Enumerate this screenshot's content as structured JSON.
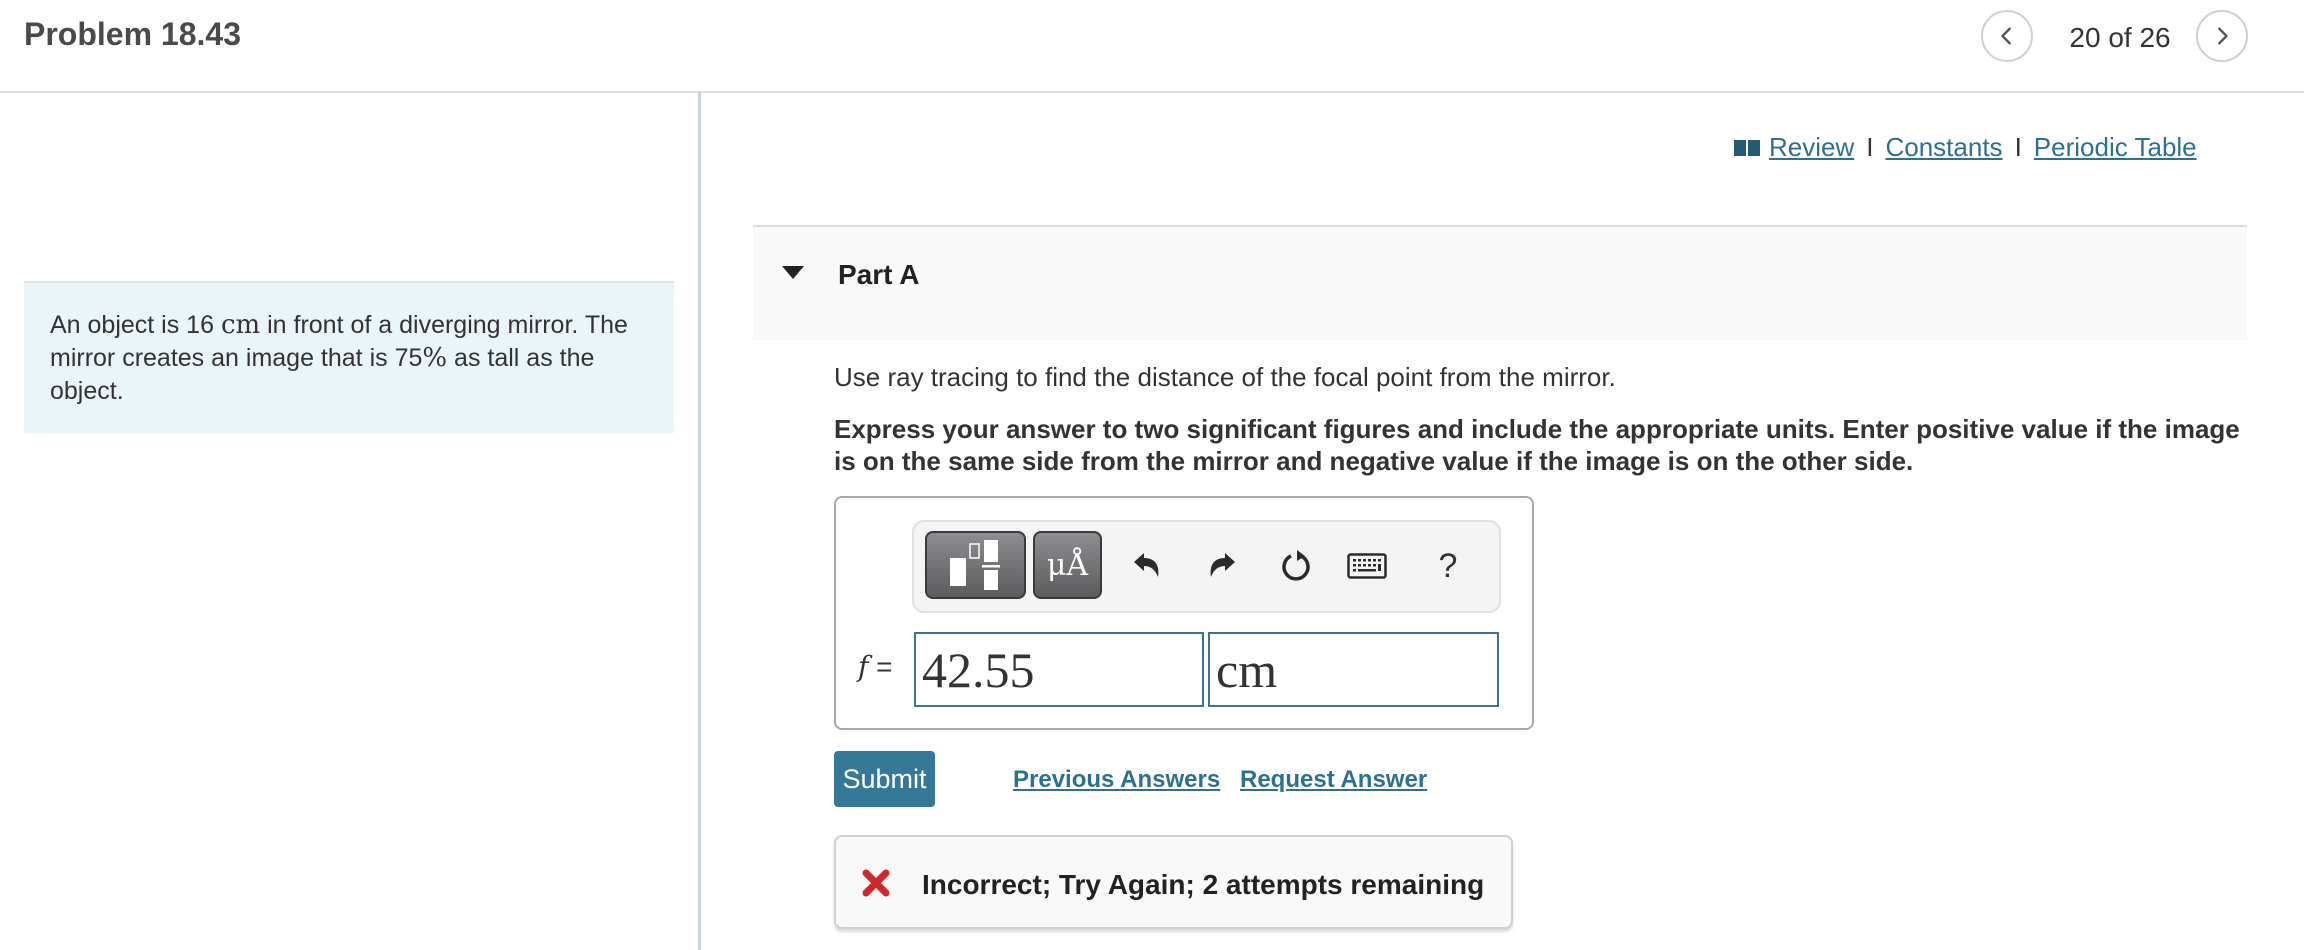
{
  "header": {
    "title": "Problem 18.43",
    "counter": "20 of 26",
    "prev_icon": "chevron-left-icon",
    "next_icon": "chevron-right-icon"
  },
  "statement": {
    "part1": "An object is 16 ",
    "unit": "cm",
    "part2": " in front of a diverging mirror. The mirror creates an image that is 75",
    "percent": "%",
    "part3": " as tall as the object."
  },
  "links": {
    "icon": "book-icon",
    "review": "Review",
    "separator": "I",
    "constants": "Constants",
    "periodic_table": "Periodic Table"
  },
  "part": {
    "title": "Part A",
    "expanded": true,
    "question": "Use ray tracing to find the distance of the focal point from the mirror.",
    "instructions": "Express your answer to two significant figures and include the appropriate units. Enter positive value if the image is on the same side from the mirror and negative value if the image is on the other side."
  },
  "answer": {
    "variable": "f",
    "equals": "=",
    "value": "42.55",
    "units": "cm",
    "toolbar": {
      "template_icon": "templates-icon",
      "units_label": "μÅ",
      "undo_icon": "undo-icon",
      "redo_icon": "redo-icon",
      "reset_icon": "reset-icon",
      "keyboard_icon": "keyboard-icon",
      "help_label": "?"
    }
  },
  "actions": {
    "submit": "Submit",
    "previous_answers": "Previous Answers",
    "request_answer": "Request Answer"
  },
  "feedback": {
    "icon": "x-icon",
    "text": "Incorrect; Try Again; 2 attempts remaining",
    "color": "#d0272b"
  },
  "colors": {
    "accent": "#367898",
    "link": "#2c7193",
    "statement_bg": "#e9f5f8"
  }
}
